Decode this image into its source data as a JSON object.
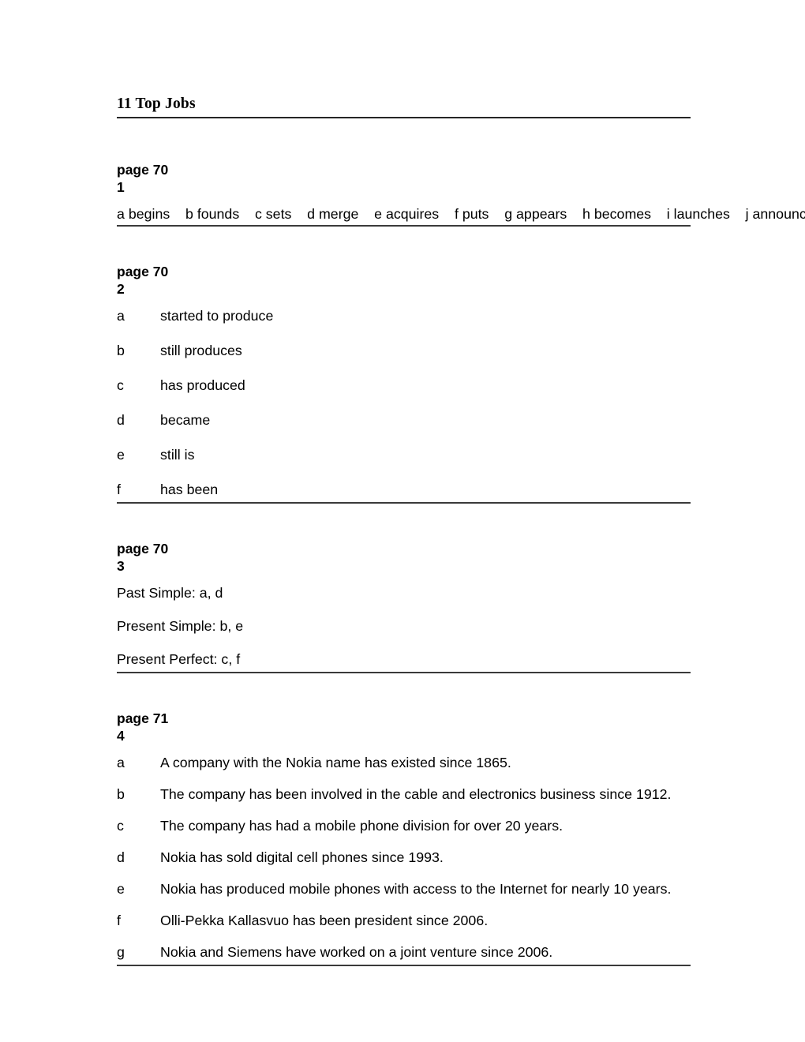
{
  "document": {
    "title": "11 Top Jobs"
  },
  "sections": [
    {
      "page_label": "page 70",
      "exercise_number": "1",
      "answer_run": "a begins    b founds    c sets    d merge    e acquires    f puts    g appears    h becomes    i launches    j announce"
    },
    {
      "page_label": "page 70",
      "exercise_number": "2",
      "items": [
        {
          "letter": "a",
          "text": "started to produce"
        },
        {
          "letter": "b",
          "text": "still produces"
        },
        {
          "letter": "c",
          "text": "has produced"
        },
        {
          "letter": "d",
          "text": "became"
        },
        {
          "letter": "e",
          "text": "still is"
        },
        {
          "letter": "f",
          "text": "has been"
        }
      ]
    },
    {
      "page_label": "page 70",
      "exercise_number": "3",
      "lines": [
        "Past Simple: a, d",
        "Present Simple: b, e",
        "Present Perfect: c, f"
      ]
    },
    {
      "page_label": "page 71",
      "exercise_number": "4",
      "items": [
        {
          "letter": "a",
          "text": "A company with the Nokia name has existed since 1865."
        },
        {
          "letter": "b",
          "text": "The company has been involved in the cable and electronics business since 1912."
        },
        {
          "letter": "c",
          "text": "The company has had a mobile phone division for over 20 years."
        },
        {
          "letter": "d",
          "text": "Nokia has sold digital cell phones since 1993."
        },
        {
          "letter": "e",
          "text": "Nokia has produced mobile phones with access to the Internet for nearly 10 years."
        },
        {
          "letter": "f",
          "text": "Olli-Pekka Kallasvuo has been president since 2006."
        },
        {
          "letter": "g",
          "text": "Nokia and Siemens have worked on a joint venture since 2006."
        }
      ]
    }
  ]
}
